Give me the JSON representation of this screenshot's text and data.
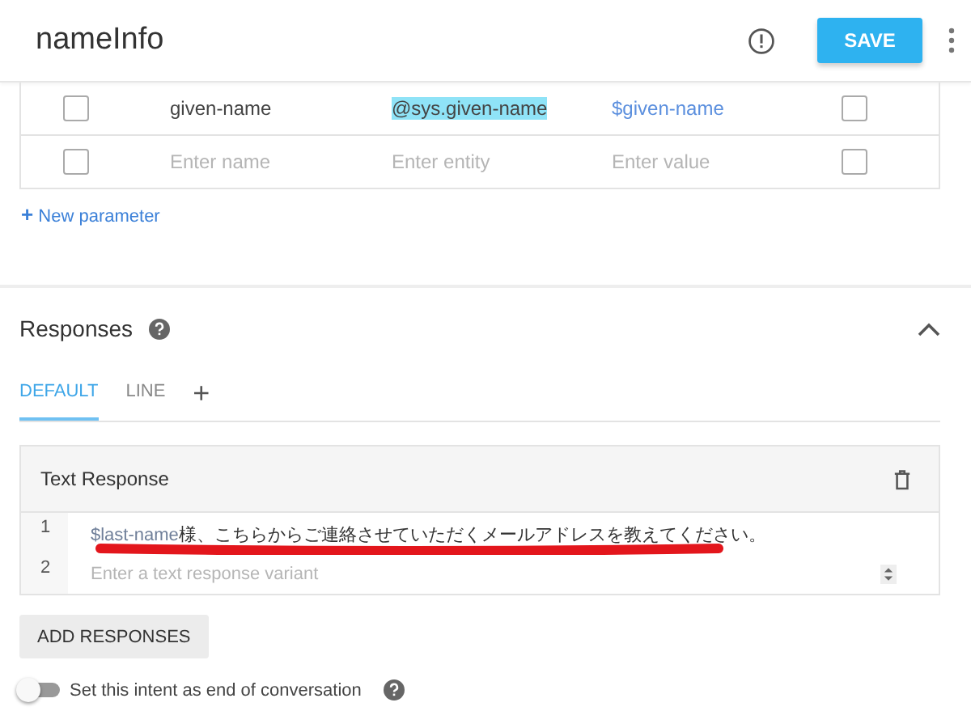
{
  "header": {
    "title": "nameInfo",
    "save_label": "SAVE"
  },
  "parameters": [
    {
      "required": false,
      "name": "given-name",
      "entity": "@sys.given-name",
      "entity_selected": true,
      "value": "$given-name",
      "is_list": false
    },
    {
      "required": false,
      "name_placeholder": "Enter name",
      "entity_placeholder": "Enter entity",
      "value_placeholder": "Enter value",
      "is_list": false
    }
  ],
  "new_parameter": {
    "icon": "+",
    "label": "New parameter"
  },
  "responses": {
    "title": "Responses",
    "expanded": true,
    "tabs": [
      {
        "label": "DEFAULT",
        "selected": true
      },
      {
        "label": "LINE",
        "selected": false
      }
    ],
    "add_tab": "+",
    "card": {
      "title": "Text Response",
      "lines": [
        {
          "number": "1",
          "param": "$last-name",
          "text": "様、こちらからご連絡させていただくメールアドレスを教えてください。",
          "underlined": true
        },
        {
          "number": "2",
          "placeholder": "Enter a text response variant"
        }
      ]
    },
    "add_button": "ADD RESPONSES",
    "end_conversation": {
      "label": "Set this intent as end of conversation",
      "on": false
    }
  }
}
